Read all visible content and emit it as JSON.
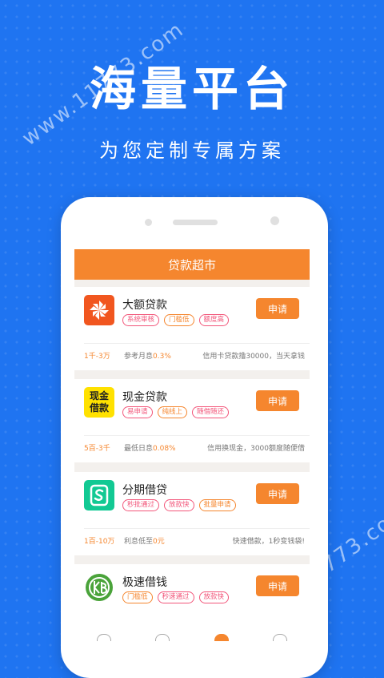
{
  "hero": {
    "title": "海量平台",
    "subtitle": "为您定制专属方案"
  },
  "watermark": "www.11773.com",
  "screen": {
    "header_title": "贷款超市",
    "apply_label": "申请",
    "products": [
      {
        "name": "大额贷款",
        "logo_icon": "pinwheel-icon",
        "logo_color": "#f1561f",
        "tags": [
          "系统审核",
          "门槛低",
          "额度高"
        ],
        "tag_colors": [
          "red",
          "orange",
          "red"
        ],
        "range": "1千-3万",
        "rate_label": "参考月息",
        "rate_value": "0.3%",
        "desc": "信用卡贷款撸30000，当天拿钱"
      },
      {
        "name": "现金贷款",
        "logo_icon": "cash-loan-icon",
        "logo_color": "#ffe100",
        "logo_text": "现金借款",
        "tags": [
          "易申请",
          "纯线上",
          "随借随还"
        ],
        "tag_colors": [
          "red",
          "orange",
          "red"
        ],
        "range": "5百-3千",
        "rate_label": "最低日息",
        "rate_value": "0.08%",
        "desc": "信用换现金，3000额度随便借"
      },
      {
        "name": "分期借贷",
        "logo_icon": "s-card-icon",
        "logo_color": "#12c993",
        "tags": [
          "秒批通过",
          "放款快",
          "批量申请"
        ],
        "tag_colors": [
          "red",
          "red",
          "orange"
        ],
        "range": "1百-10万",
        "rate_label": "利息低至",
        "rate_value": "0元",
        "desc": "快速借款，1秒变钱袋!"
      },
      {
        "name": "极速借钱",
        "logo_icon": "fast-cash-icon",
        "logo_color": "#4aa33a",
        "tags": [
          "门槛低",
          "秒速通过",
          "放款快"
        ],
        "tag_colors": [
          "orange",
          "red",
          "red"
        ]
      }
    ]
  },
  "colors": {
    "background": "#1f74f1",
    "accent": "#f5862e",
    "tag_red": "#f2567a"
  }
}
